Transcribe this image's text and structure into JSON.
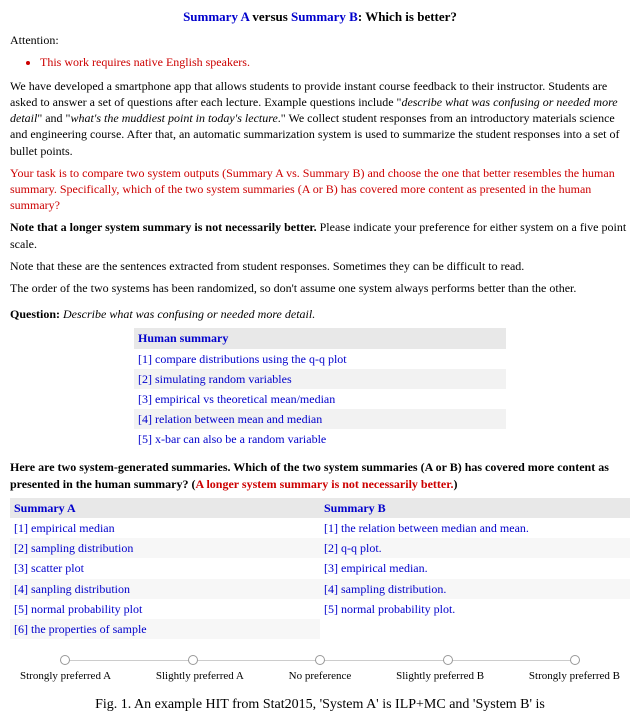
{
  "title": {
    "summary_a": "Summary A",
    "versus": " versus ",
    "summary_b": "Summary B",
    "suffix": ": Which is better?"
  },
  "attention_label": "Attention:",
  "attention_bullet": "This work requires native English speakers.",
  "para1_a": "We have developed a smartphone app that allows students to provide instant course feedback to their instructor. Students are asked to answer a set of questions after each lecture. Example questions include \"",
  "para1_q1": "describe what was confusing or needed more detail",
  "para1_b": "\" and \"",
  "para1_q2": "what's the muddiest point in today's lecture",
  "para1_c": ".\" We collect student responses from an introductory materials science and engineering course. After that, an automatic summarization system is used to summarize the student responses into a set of bullet points.",
  "task_red": "Your task is to compare two system outputs (Summary A vs. Summary B) and choose the one that better resembles the human summary. Specifically, which of the two system summaries (A or B) has covered more content as presented in the human summary?",
  "note_longer_bold": "Note that a longer system summary is not necessarily better.",
  "note_longer_rest": " Please indicate your preference for either system on a five point scale.",
  "note_sentences": "Note that these are the sentences extracted from student responses. Sometimes they can be difficult to read.",
  "note_random": "The order of the two systems has been randomized, so don't assume one system always performs better than the other.",
  "question_label": "Question:",
  "question_text": " Describe what was confusing or needed more detail.",
  "human_summary_header": "Human summary",
  "human_summary": [
    "[1] compare distributions using the q-q plot",
    "[2] simulating random variables",
    "[3] empirical vs theoretical mean/median",
    "[4] relation between mean and median",
    "[5] x-bar can also be a random variable"
  ],
  "instruction_main": "Here are two system-generated summaries. Which of the two system summaries (A or B) has covered more content as presented in the human summary? (",
  "instruction_red": "A longer system summary is not necessarily better.",
  "instruction_close": ")",
  "colA_header": "Summary A",
  "colB_header": "Summary B",
  "summaryA": [
    "[1] empirical median",
    "[2] sampling distribution",
    "[3] scatter plot",
    "[4] sanpling distribution",
    "[5] normal probability plot",
    "[6] the properties of sample"
  ],
  "summaryB": [
    "[1] the relation between median and mean.",
    "[2] q-q plot.",
    "[3] empirical median.",
    "[4] sampling distribution.",
    "[5] normal probability plot."
  ],
  "slider": [
    "Strongly preferred A",
    "Slightly preferred A",
    "No preference",
    "Slightly preferred B",
    "Strongly preferred B"
  ],
  "caption": "Fig. 1. An example HIT from Stat2015, 'System A' is ILP+MC and 'System B' is"
}
